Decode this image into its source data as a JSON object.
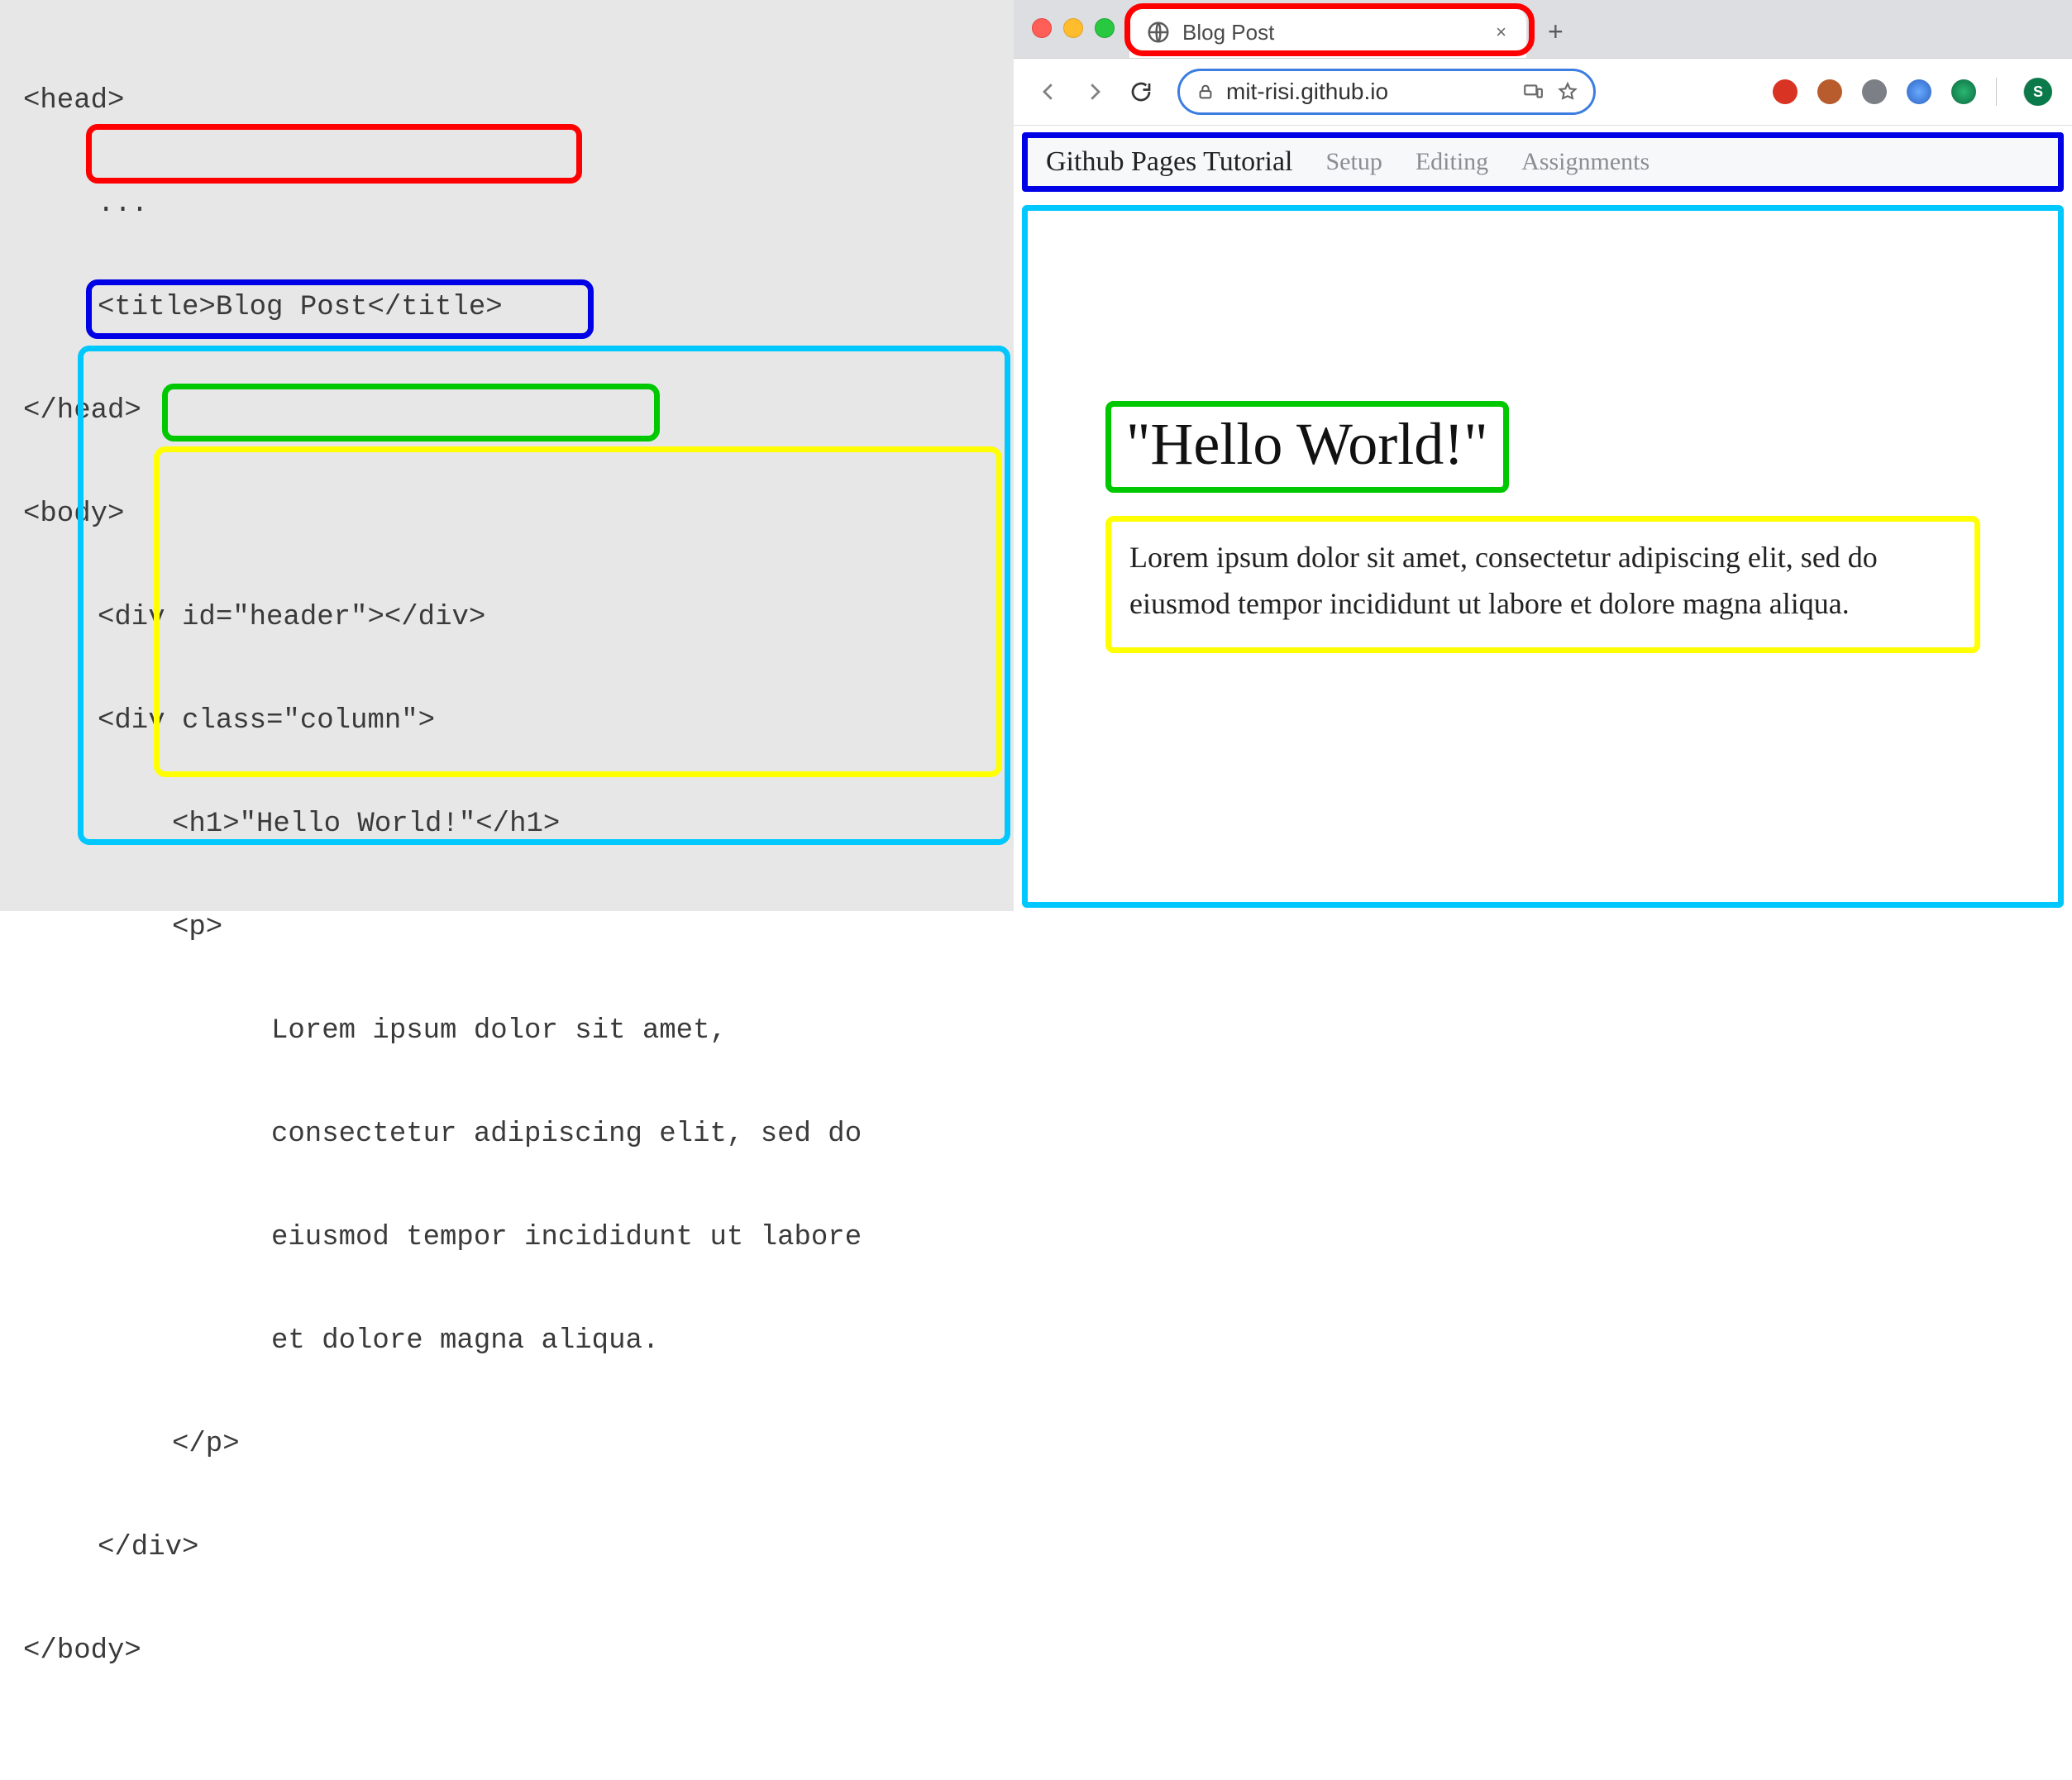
{
  "code": {
    "l1": "<head>",
    "l2": "...",
    "l3": "<title>Blog Post</title>",
    "l4": "</head>",
    "l5": "<body>",
    "l6": "<div id=\"header\"></div>",
    "l7": "<div class=\"column\">",
    "l8": "<h1>\"Hello World!\"</h1>",
    "l9": "<p>",
    "l10": "Lorem ipsum dolor sit amet,",
    "l11": "consectetur adipiscing elit, sed do",
    "l12": "eiusmod tempor incididunt ut labore",
    "l13": "et dolore magna aliqua.",
    "l14": "</p>",
    "l15": "</div>",
    "l16": "</body>"
  },
  "browser": {
    "tab_title": "Blog Post",
    "tab_close": "×",
    "new_tab": "+",
    "url": "mit-risi.github.io",
    "avatar_letter": "S"
  },
  "page": {
    "nav": {
      "brand": "Github Pages Tutorial",
      "links": [
        "Setup",
        "Editing",
        "Assignments"
      ]
    },
    "heading": "\"Hello World!\"",
    "paragraph": "Lorem ipsum dolor sit amet, consectetur adipiscing elit, sed do eiusmod tempor incididunt ut labore et dolore magna aliqua."
  },
  "annotation_colors": {
    "title_tag": "#ff0000",
    "header_div": "#0000e6",
    "column_div": "#00c8ff",
    "h1": "#00c800",
    "paragraph": "#ffff00"
  }
}
